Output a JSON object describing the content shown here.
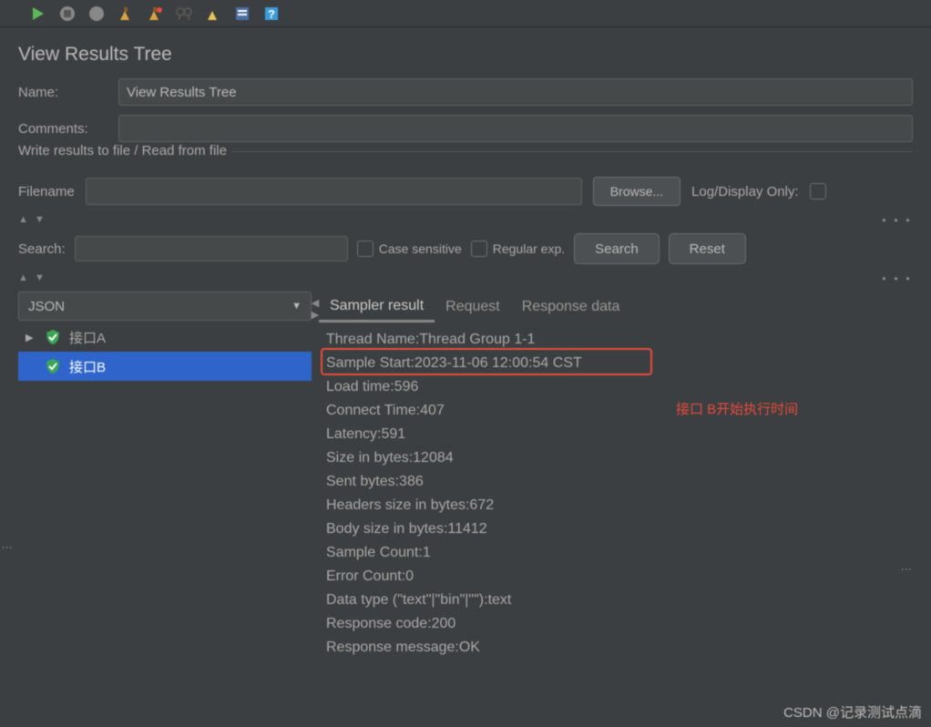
{
  "title": "View Results Tree",
  "form": {
    "name_label": "Name:",
    "name_value": "View Results Tree",
    "comments_label": "Comments:",
    "comments_value": ""
  },
  "file_section": {
    "legend": "Write results to file / Read from file",
    "filename_label": "Filename",
    "filename_value": "",
    "browse_label": "Browse...",
    "logdisplay_label": "Log/Display Only:"
  },
  "search": {
    "label": "Search:",
    "value": "",
    "case_label": "Case sensitive",
    "regex_label": "Regular exp.",
    "search_btn": "Search",
    "reset_btn": "Reset"
  },
  "renderer": {
    "selected": "JSON"
  },
  "tree": {
    "items": [
      {
        "label": "接口A",
        "expandable": true
      },
      {
        "label": "接口B",
        "expandable": false
      }
    ]
  },
  "tabs": {
    "items": [
      "Sampler result",
      "Request",
      "Response data"
    ],
    "active": 0
  },
  "result_lines": [
    "Thread Name:Thread Group 1-1",
    "Sample Start:2023-11-06 12:00:54 CST",
    "Load time:596",
    "Connect Time:407",
    "Latency:591",
    "Size in bytes:12084",
    "Sent bytes:386",
    "Headers size in bytes:672",
    "Body size in bytes:11412",
    "Sample Count:1",
    "Error Count:0",
    "Data type (\"text\"|\"bin\"|\"\"):text",
    "Response code:200",
    "Response message:OK"
  ],
  "annotation": "接口 B开始执行时间",
  "watermark": "CSDN @记录测试点滴"
}
